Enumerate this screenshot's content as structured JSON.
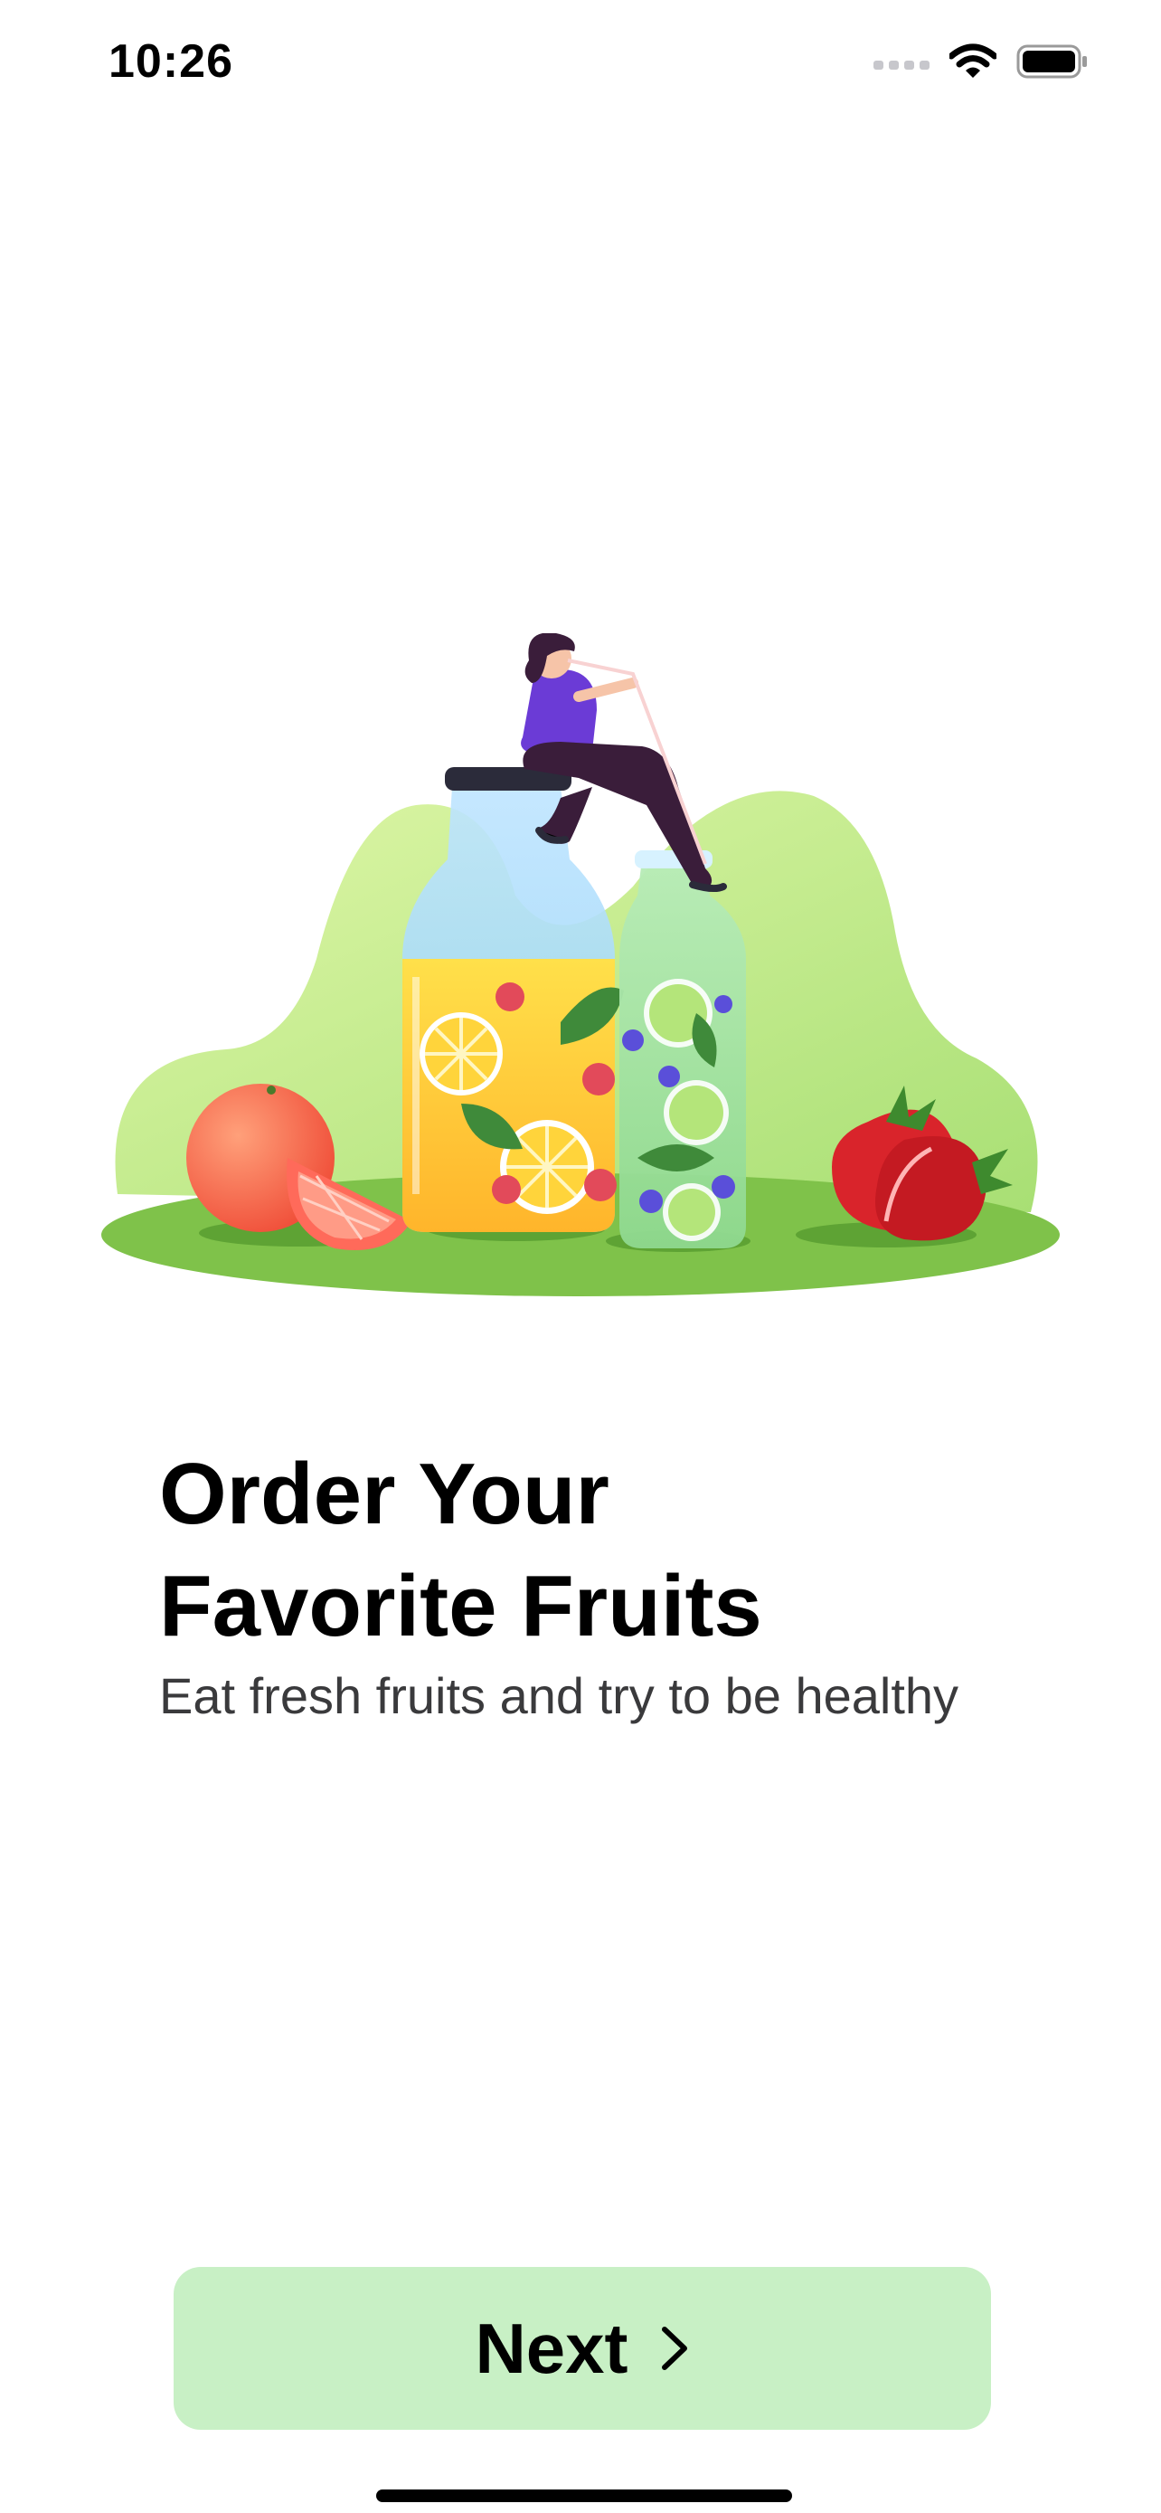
{
  "status_bar": {
    "time": "10:26",
    "icons": [
      "cellular-signal-icon",
      "wifi-icon",
      "battery-icon"
    ]
  },
  "onboarding": {
    "illustration": "woman-drinking-fruit-juice-illustration",
    "title_line1": "Order Your",
    "title_line2": "Favorite Fruits",
    "subtitle": "Eat fresh fruits and try to be healthy"
  },
  "actions": {
    "next_label": "Next",
    "next_icon": "chevron-right-icon"
  },
  "colors": {
    "button_background": "#c8f0c5",
    "subtitle_text": "#3a3a3c",
    "text": "#000000",
    "background": "#ffffff"
  }
}
